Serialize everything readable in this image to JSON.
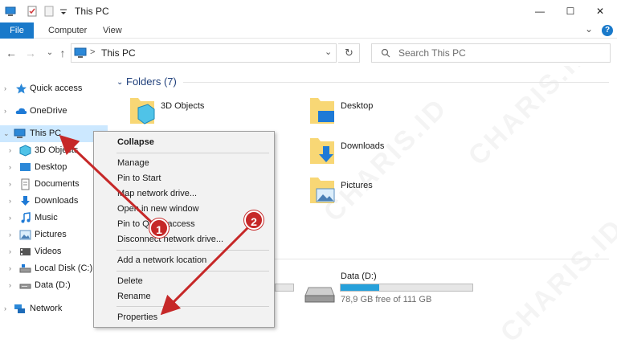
{
  "window": {
    "title": "This PC",
    "controls": {
      "minimize": "—",
      "maximize": "☐",
      "close": "✕"
    }
  },
  "ribbon": {
    "tabs": [
      {
        "label": "File"
      },
      {
        "label": "Computer"
      },
      {
        "label": "View"
      }
    ],
    "help": "?",
    "expand": "⌄"
  },
  "navbar": {
    "back": "←",
    "forward": "→",
    "recent": "⌄",
    "up": "↑",
    "address_separator": ">",
    "address": "This PC",
    "address_dropdown": "⌄",
    "refresh": "↻",
    "search_placeholder": "Search This PC"
  },
  "nav_pane": {
    "items": [
      {
        "label": "Quick access",
        "icon": "star-icon"
      },
      {
        "label": "OneDrive",
        "icon": "cloud-icon"
      },
      {
        "label": "This PC",
        "icon": "computer-icon"
      },
      {
        "label": "3D Objects",
        "icon": "cube-icon"
      },
      {
        "label": "Desktop",
        "icon": "desktop-icon"
      },
      {
        "label": "Documents",
        "icon": "document-icon"
      },
      {
        "label": "Downloads",
        "icon": "download-icon"
      },
      {
        "label": "Music",
        "icon": "music-icon"
      },
      {
        "label": "Pictures",
        "icon": "picture-icon"
      },
      {
        "label": "Videos",
        "icon": "video-icon"
      },
      {
        "label": "Local Disk (C:)",
        "icon": "drive-icon"
      },
      {
        "label": "Data (D:)",
        "icon": "drive-icon"
      },
      {
        "label": "Network",
        "icon": "network-icon"
      }
    ]
  },
  "main": {
    "folders_heading": "Folders (7)",
    "folders": [
      {
        "label": "3D Objects"
      },
      {
        "label": "Desktop"
      },
      {
        "label": "Downloads"
      },
      {
        "label": "Pictures"
      }
    ],
    "drives": [
      {
        "label": "Data (D:)",
        "free": "78,9 GB free of 111 GB",
        "used_fraction": 0.29
      }
    ]
  },
  "context_menu": {
    "items": [
      {
        "label": "Collapse"
      },
      {
        "label": "Manage"
      },
      {
        "label": "Pin to Start"
      },
      {
        "label": "Map network drive..."
      },
      {
        "label": "Open in new window"
      },
      {
        "label": "Pin to Quick access"
      },
      {
        "label": "Disconnect network drive..."
      },
      {
        "label": "Add a network location"
      },
      {
        "label": "Delete"
      },
      {
        "label": "Rename"
      },
      {
        "label": "Properties"
      }
    ]
  },
  "annotations": {
    "badge_1": "1",
    "badge_2": "2",
    "arrow_color": "#c62828"
  },
  "watermark": "CHARIS.ID",
  "colors": {
    "accent": "#1979ca",
    "selection": "#cce8ff",
    "folder": "#f8d775",
    "drive_bar": "#26a0da"
  }
}
